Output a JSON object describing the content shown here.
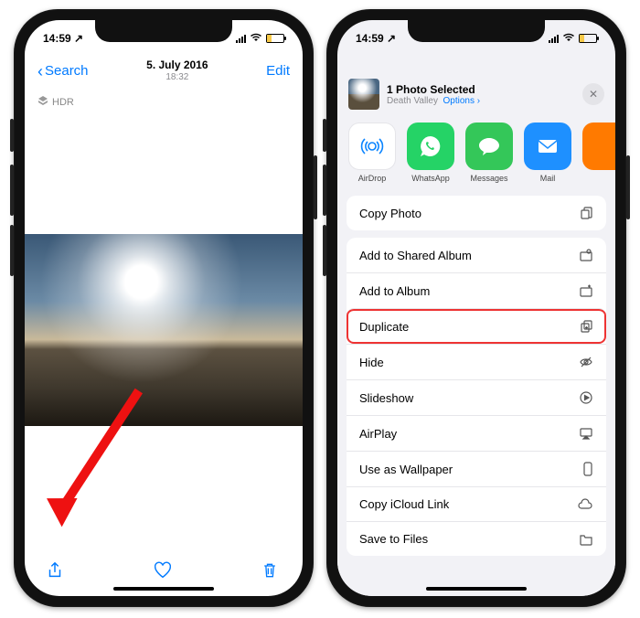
{
  "statusbar": {
    "time": "14:59"
  },
  "left": {
    "back_label": "Search",
    "date": "5. July 2016",
    "subtime": "18:32",
    "edit_label": "Edit",
    "badge": "HDR"
  },
  "share": {
    "title": "1 Photo Selected",
    "location": "Death Valley",
    "options_label": "Options",
    "apps": [
      {
        "id": "airdrop",
        "label": "AirDrop"
      },
      {
        "id": "whatsapp",
        "label": "WhatsApp"
      },
      {
        "id": "messages",
        "label": "Messages"
      },
      {
        "id": "mail",
        "label": "Mail"
      }
    ],
    "single_actions": [
      {
        "label": "Copy Photo",
        "icon": "copy"
      }
    ],
    "actions": [
      {
        "label": "Add to Shared Album",
        "icon": "shared-album"
      },
      {
        "label": "Add to Album",
        "icon": "album"
      },
      {
        "label": "Duplicate",
        "icon": "duplicate",
        "highlighted": true
      },
      {
        "label": "Hide",
        "icon": "hide"
      },
      {
        "label": "Slideshow",
        "icon": "play"
      },
      {
        "label": "AirPlay",
        "icon": "airplay"
      },
      {
        "label": "Use as Wallpaper",
        "icon": "wallpaper"
      },
      {
        "label": "Copy iCloud Link",
        "icon": "cloud"
      },
      {
        "label": "Save to Files",
        "icon": "folder"
      }
    ]
  }
}
